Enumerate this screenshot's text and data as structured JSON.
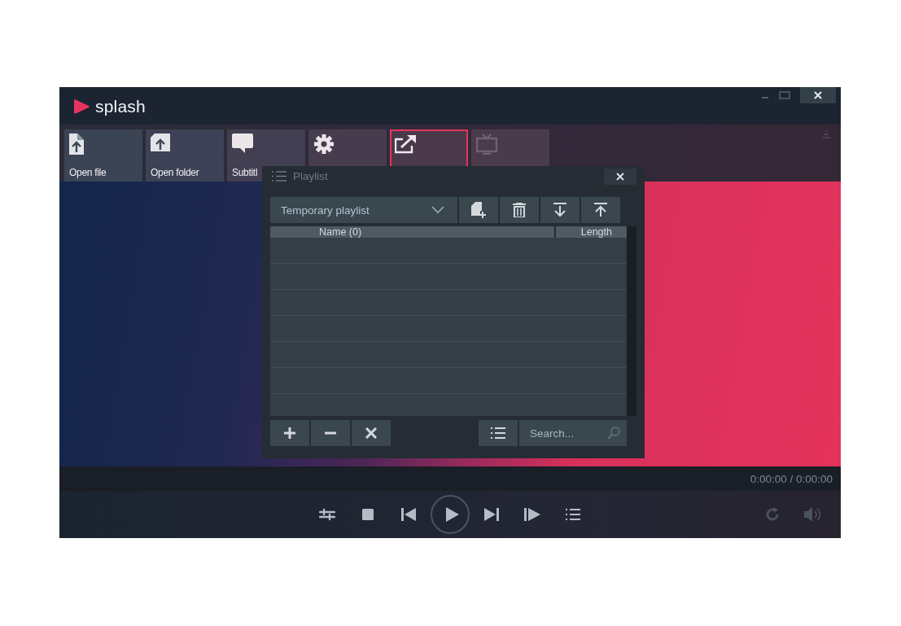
{
  "window": {
    "logo": "splash"
  },
  "toolbar": [
    {
      "kind": "file",
      "label": "Open file",
      "selected": false,
      "disabled": false
    },
    {
      "kind": "folder",
      "label": "Open folder",
      "selected": false,
      "disabled": false
    },
    {
      "kind": "subtitles",
      "label": "Subtitl",
      "selected": false,
      "disabled": false
    },
    {
      "kind": "settings",
      "selected": false,
      "disabled": false
    },
    {
      "kind": "cast",
      "selected": true,
      "disabled": false
    },
    {
      "kind": "tv",
      "selected": false,
      "disabled": true
    }
  ],
  "playlist": {
    "title": "Playlist",
    "playlist_name": "Temporary playlist",
    "columns": [
      "Name (0)",
      "Length"
    ],
    "search": {
      "placeholder": "Search..."
    }
  },
  "time": "0:00:00 / 0:00:00"
}
